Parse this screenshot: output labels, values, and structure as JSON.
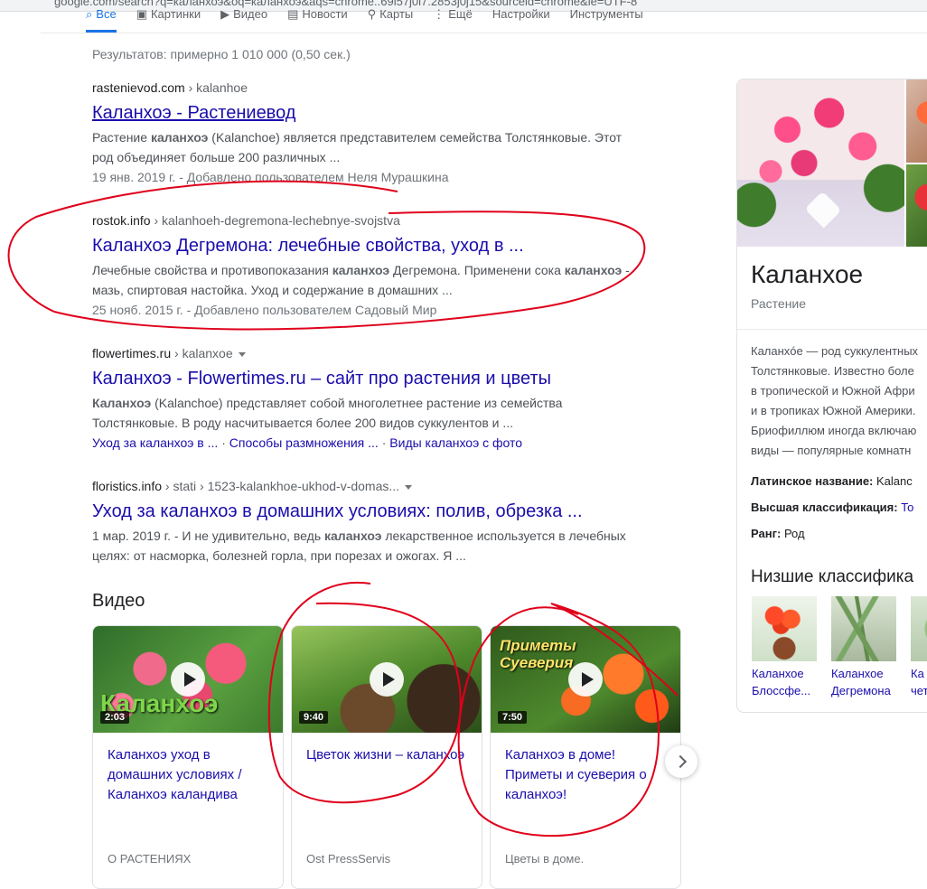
{
  "url_bar": "google.com/search?q=каланхоэ&oq=каланхоэ&aqs=chrome..69i57j0l7.2853j0j15&sourceid=chrome&ie=UTF-8",
  "tabs": [
    {
      "label": "Все",
      "active": true
    },
    {
      "label": "Картинки"
    },
    {
      "label": "Видео"
    },
    {
      "label": "Новости"
    },
    {
      "label": "Карты"
    },
    {
      "label": "Ещё"
    },
    {
      "label": "Настройки"
    },
    {
      "label": "Инструменты"
    }
  ],
  "stats": "Результатов: примерно 1 010 000 (0,50 сек.)",
  "results": [
    {
      "domain": "rastenievod.com",
      "path": " › kalanhoe",
      "title": "Каланхоэ - Растениевод",
      "snippet_html": "Растение <b>каланхоэ</b> (Kalanchoe) является представителем семейства Толстянковые. Этот род объединяет больше 200 различных ...",
      "meta": "19 янв. 2019 г. - Добавлено пользователем Неля Мурашкина"
    },
    {
      "domain": "rostok.info",
      "path": " › kalanhoeh-degremona-lechebnye-svojstva",
      "title": "Каланхоэ Дегремона: лечебные свойства, уход в ...",
      "snippet_html": "Лечебные свойства и противопоказания <b>каланхоэ</b> Дегремона. Применени сока <b>каланхоэ</b> - мазь, спиртовая настойка. Уход и содержание в домашних ...",
      "meta": "25 нояб. 2015 г. - Добавлено пользователем Садовый Мир"
    },
    {
      "domain": "flowertimes.ru",
      "path": " › kalanxoe",
      "title": "Каланхоэ - Flowertimes.ru – сайт про растения и цветы",
      "snippet_html": "<b>Каланхоэ</b> (Kalanchoe) представляет собой многолетнее растение из семейства Толстянковые. В роду насчитывается более 200 видов суккулентов и ...",
      "sitelinks": [
        "Уход за каланхоэ в ...",
        "Способы размножения ...",
        "Виды каланхоэ с фото"
      ]
    },
    {
      "domain": "floristics.info",
      "path": " › stati › 1523-kalankhoe-ukhod-v-domas...",
      "title": "Уход за каланхоэ в домашних условиях: полив, обрезка ...",
      "snippet_html": "1 мар. 2019 г. - И не удивительно, ведь <b>каланхоэ</b> лекарственное используется в лечебных целях: от насморка, болезней горла, при порезах и ожогах. Я ..."
    }
  ],
  "video_heading": "Видео",
  "videos": [
    {
      "title": "Каланхоэ уход в домашних условиях / Каланхоэ каландива",
      "duration": "2:03",
      "source": "О РАСТЕНИЯХ",
      "overlay": "Каланхоэ"
    },
    {
      "title": "Цветок жизни – каланхоэ",
      "duration": "9:40",
      "source": "Ost PressServis"
    },
    {
      "title": "Каланхоэ в доме! Приметы и суеверия о каланхоэ!",
      "duration": "7:50",
      "source": "Цветы в доме.",
      "overlay": "Приметы Суеверия"
    }
  ],
  "knowledge_panel": {
    "title": "Каланхое",
    "subtitle": "Растение",
    "description": "Каланхóе — род суккулентных\nТолстянковые. Известно боле\nв тропической и Южной Афри\nи в тропиках Южной Америки.\nБриофиллюм иногда включаю\nвиды — популярные комнатн",
    "facts": [
      {
        "label": "Латинское название:",
        "value": "Kalanc",
        "link": false
      },
      {
        "label": "Высшая классификация:",
        "value": "То",
        "link": true
      },
      {
        "label": "Ранг:",
        "value": "Род",
        "link": false
      }
    ],
    "lower_heading": "Низшие классифика",
    "lower_items": [
      {
        "label": "Каланхое\nБлоссфе..."
      },
      {
        "label": "Каланхое\nДегремона"
      },
      {
        "label": "Ка\nчет"
      }
    ]
  },
  "colors": {
    "link": "#1a0dab",
    "accent": "#1a73e8",
    "annotation": "#e0001b"
  }
}
